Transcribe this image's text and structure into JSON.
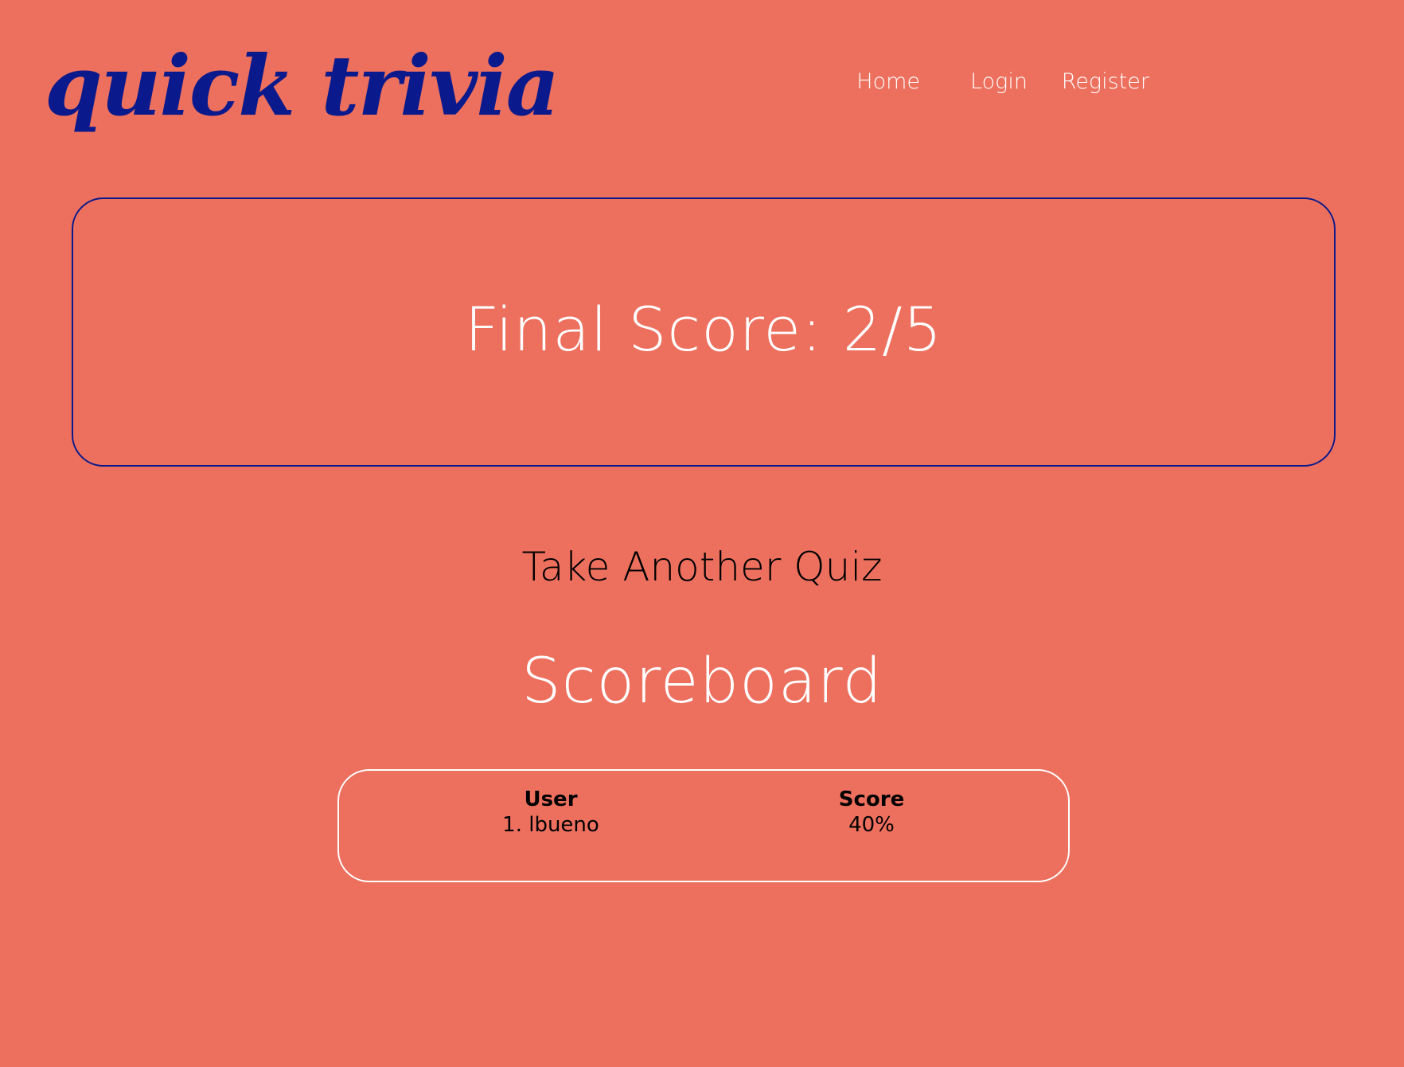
{
  "header": {
    "logo": "quick trivia",
    "nav": [
      {
        "label": "Home"
      },
      {
        "label": "Login"
      },
      {
        "label": "Register"
      }
    ]
  },
  "result": {
    "final_score": "Final Score: 2/5"
  },
  "actions": {
    "take_another": "Take Another Quiz"
  },
  "scoreboard": {
    "title": "Scoreboard",
    "columns": {
      "user": "User",
      "score": "Score"
    },
    "rows": [
      {
        "user": "1. lbueno",
        "score": "40%"
      }
    ]
  },
  "colors": {
    "background": "#ed705e",
    "brand": "#0a1a8c",
    "text_light": "#ffffff",
    "text_dark": "#000000"
  }
}
